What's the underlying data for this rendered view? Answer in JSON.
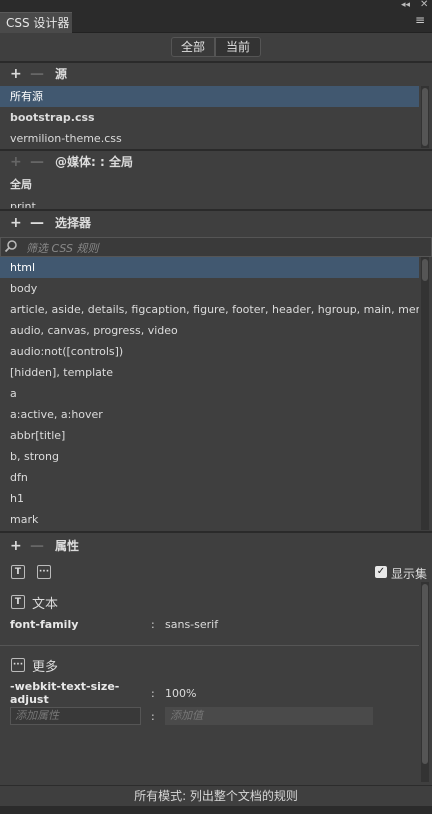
{
  "panel": {
    "tab_label": "CSS 设计器",
    "collapse_icon": "double-chevron-left-icon",
    "close_icon": "close-icon",
    "menu_icon": "hamburger-menu-icon"
  },
  "mode_toggle": {
    "all": "全部",
    "current": "当前",
    "selected": "all"
  },
  "sources": {
    "add": "+",
    "remove": "—",
    "title": "源",
    "items": [
      {
        "label": "所有源",
        "selected": true
      },
      {
        "label": "bootstrap.css",
        "bold": true
      },
      {
        "label": "vermilion-theme.css"
      }
    ]
  },
  "media": {
    "add": "+",
    "remove": "—",
    "title": "@媒体: : 全局",
    "items": [
      {
        "label": "全局"
      },
      {
        "label": "print"
      }
    ]
  },
  "selectors": {
    "add": "+",
    "remove": "—",
    "title": "选择器",
    "filter_placeholder": "筛选 CSS 规则",
    "items": [
      "html",
      "body",
      "article, aside, details, figcaption, figure, footer, header, hgroup, main, menu,...",
      "audio, canvas, progress, video",
      "audio:not([controls])",
      "[hidden], template",
      "a",
      "a:active, a:hover",
      "abbr[title]",
      "b, strong",
      "dfn",
      "h1",
      "mark"
    ],
    "selected_index": 0
  },
  "properties": {
    "add": "+",
    "remove": "—",
    "title": "属性",
    "text_icon": "T",
    "more_icon": "···",
    "show_set_label": "显示集",
    "show_set_checked": true,
    "text_section": {
      "title": "文本",
      "name": "font-family",
      "value": "sans-serif"
    },
    "more_section": {
      "title": "更多",
      "name_line1": "-webkit-text-size-",
      "name_line2": "adjust",
      "value": "100%",
      "add_property_placeholder": "添加属性",
      "add_value_placeholder": "添加值"
    },
    "colon": ":"
  },
  "status_bar": "所有模式: 列出整个文档的规则"
}
